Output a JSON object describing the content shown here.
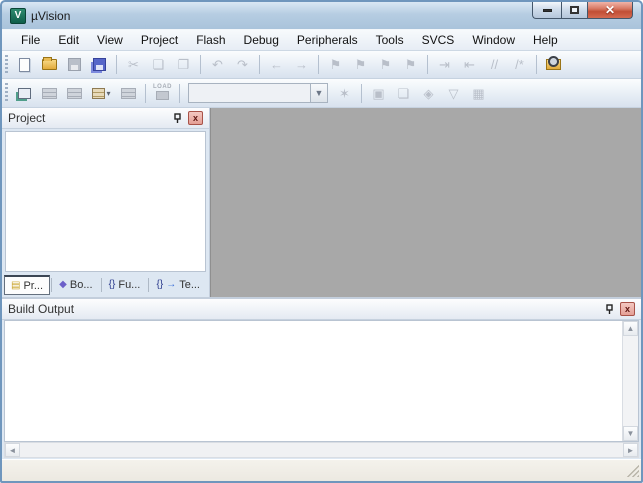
{
  "window": {
    "title": "µVision",
    "logo_text": "V",
    "controls": {
      "minimize": "minimize",
      "maximize": "maximize",
      "close_glyph": "✕"
    }
  },
  "menu": {
    "items": [
      "File",
      "Edit",
      "View",
      "Project",
      "Flash",
      "Debug",
      "Peripherals",
      "Tools",
      "SVCS",
      "Window",
      "Help"
    ]
  },
  "toolbars": {
    "row1": [
      {
        "name": "new-file",
        "css": "doc",
        "disabled": false
      },
      {
        "name": "open-file",
        "css": "folder",
        "disabled": false
      },
      {
        "name": "save",
        "css": "floppy",
        "disabled": true
      },
      {
        "name": "save-all",
        "css": "floppy2",
        "disabled": false
      },
      {
        "sep": true
      },
      {
        "name": "cut",
        "glyph": "✂",
        "disabled": true
      },
      {
        "name": "copy",
        "glyph": "❏",
        "disabled": true
      },
      {
        "name": "paste",
        "glyph": "❐",
        "disabled": true
      },
      {
        "sep": true
      },
      {
        "name": "undo",
        "glyph": "↶",
        "disabled": true
      },
      {
        "name": "redo",
        "glyph": "↷",
        "disabled": true
      },
      {
        "sep": true
      },
      {
        "name": "navigate-back",
        "glyph": "←",
        "disabled": true
      },
      {
        "name": "navigate-forward",
        "glyph": "→",
        "disabled": true
      },
      {
        "sep": true
      },
      {
        "name": "toggle-bookmark",
        "glyph": "⚑",
        "disabled": true
      },
      {
        "name": "next-bookmark",
        "glyph": "⚑",
        "disabled": true
      },
      {
        "name": "previous-bookmark",
        "glyph": "⚑",
        "disabled": true
      },
      {
        "name": "clear-bookmarks",
        "glyph": "⚑",
        "disabled": true
      },
      {
        "sep": true
      },
      {
        "name": "indent",
        "glyph": "⇥",
        "disabled": true
      },
      {
        "name": "unindent",
        "glyph": "⇤",
        "disabled": true
      },
      {
        "name": "comment-selection",
        "glyph": "//",
        "disabled": true
      },
      {
        "name": "uncomment-selection",
        "glyph": "/*",
        "disabled": true
      },
      {
        "sep": true
      },
      {
        "name": "find-in-files",
        "css": "folderfind",
        "disabled": false
      }
    ],
    "row2": [
      {
        "name": "translate",
        "css": "papers",
        "disabled": false
      },
      {
        "name": "build",
        "css": "bricks",
        "disabled": true
      },
      {
        "name": "rebuild",
        "css": "bricks",
        "disabled": true
      },
      {
        "name": "batch-build",
        "css": "bricks-c",
        "disabled": false,
        "dropdown": true
      },
      {
        "name": "stop-build",
        "css": "bricks",
        "disabled": true
      },
      {
        "sep": true
      },
      {
        "name": "download-load",
        "css": "chip",
        "disabled": true,
        "label": "LOAD"
      },
      {
        "sep": true
      },
      {
        "combo": true
      },
      {
        "name": "options-for-target",
        "glyph": "✶",
        "disabled": true
      },
      {
        "sep": true
      },
      {
        "name": "manage-project-items",
        "glyph": "▣",
        "disabled": true
      },
      {
        "name": "windows-cascade",
        "glyph": "❏",
        "disabled": true
      },
      {
        "name": "component-viewer",
        "glyph": "◈",
        "disabled": true
      },
      {
        "name": "function-filter",
        "glyph": "▽",
        "disabled": true
      },
      {
        "name": "pack-mesh",
        "glyph": "▦",
        "disabled": true
      }
    ],
    "target_select": {
      "value": "",
      "dropdown_glyph": "▼"
    }
  },
  "project_panel": {
    "title": "Project",
    "pin_glyph": "⊥",
    "close_glyph": "x",
    "tabs": [
      {
        "name": "project",
        "label": "Pr...",
        "icon": "▤",
        "icon_color": "#c9a227",
        "active": true
      },
      {
        "name": "books",
        "label": "Bo...",
        "icon": "◆",
        "icon_color": "#6b5fc9",
        "active": false
      },
      {
        "name": "functions",
        "label": "Fu...",
        "icon": "{}",
        "icon_color": "#2b3a8c",
        "active": false
      },
      {
        "name": "templates",
        "label": "Te...",
        "icon": "{}",
        "icon_color": "#2b3a8c",
        "icon_suffix": "→",
        "icon_suffix_color": "#3a6fd8",
        "active": false
      }
    ]
  },
  "build_output": {
    "title": "Build Output",
    "pin_glyph": "⊥",
    "close_glyph": "x",
    "content": "",
    "scroll": {
      "up": "▲",
      "down": "▼",
      "left": "◄",
      "right": "►"
    }
  },
  "status_bar": {
    "text": ""
  },
  "colors": {
    "titlebar": "#b6cde2",
    "window_border": "#6f96bd",
    "mdi_background": "#a8a8a8",
    "panel_surround": "#dde7f2",
    "close_button_red": "#c14e35"
  }
}
